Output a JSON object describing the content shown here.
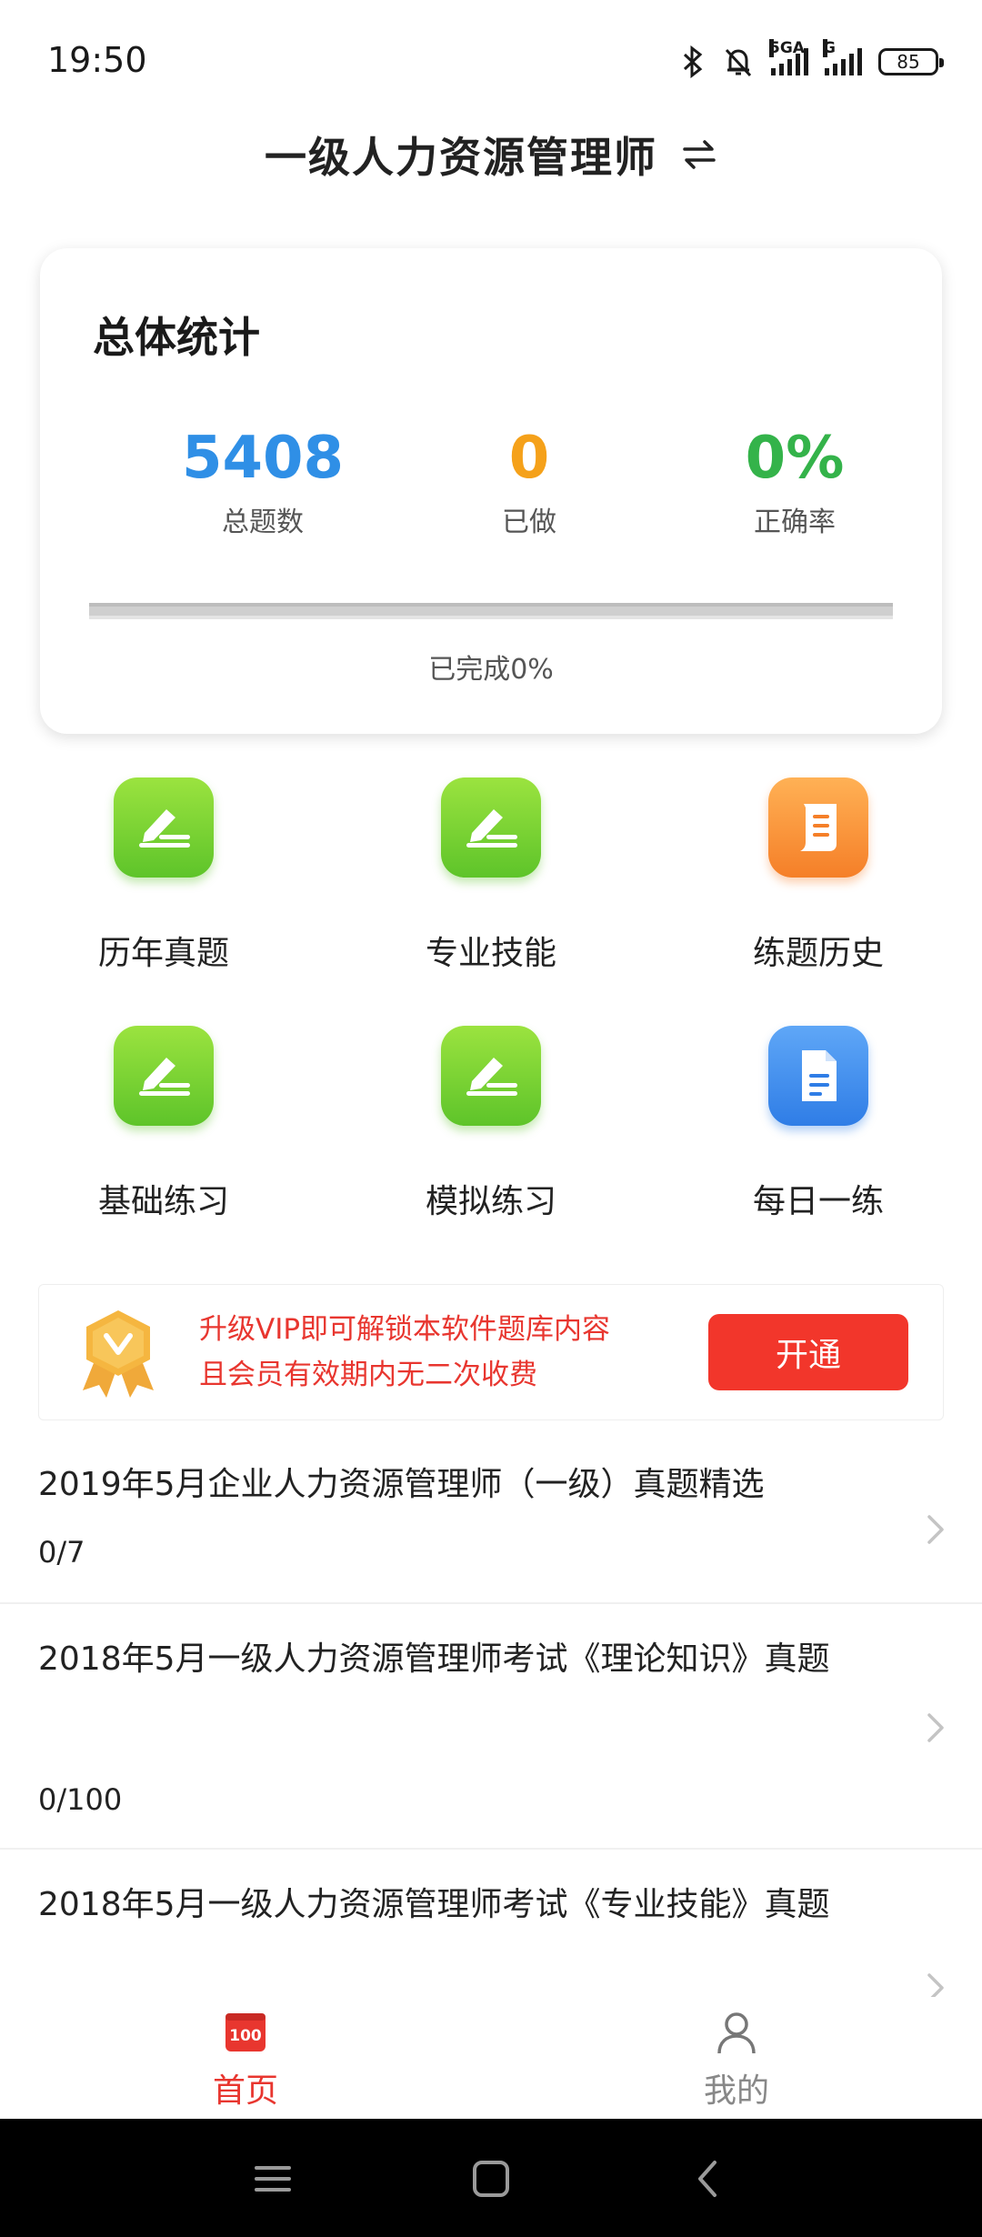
{
  "status": {
    "time": "19:50",
    "network1": "5GA",
    "network2": "G",
    "battery": "85"
  },
  "header": {
    "title": "一级人力资源管理师",
    "switch_icon": "swap-arrows-icon"
  },
  "stats": {
    "title": "总体统计",
    "total_value": "5408",
    "total_label": "总题数",
    "done_value": "0",
    "done_label": "已做",
    "rate_value": "0%",
    "rate_label": "正确率",
    "progress_fraction": 0,
    "progress_text": "已完成0%",
    "colors": {
      "total": "#2f8fe6",
      "done": "#f5a11a",
      "rate": "#34b34a"
    }
  },
  "grid": {
    "items": [
      {
        "label": "历年真题",
        "icon": "edit-pen-icon",
        "color": "green"
      },
      {
        "label": "专业技能",
        "icon": "edit-pen-icon",
        "color": "green"
      },
      {
        "label": "练题历史",
        "icon": "scroll-document-icon",
        "color": "orange"
      },
      {
        "label": "基础练习",
        "icon": "edit-pen-icon",
        "color": "green"
      },
      {
        "label": "模拟练习",
        "icon": "edit-pen-icon",
        "color": "green"
      },
      {
        "label": "每日一练",
        "icon": "file-icon",
        "color": "blue"
      }
    ]
  },
  "vip": {
    "line1": "升级VIP即可解锁本软件题库内容",
    "line2": "且会员有效期内无二次收费",
    "button": "开通",
    "accent": "#f2362b"
  },
  "list": [
    {
      "title": "2019年5月企业人力资源管理师（一级）真题精选",
      "progress": "0/7"
    },
    {
      "title": "2018年5月一级人力资源管理师考试《理论知识》真题",
      "progress": "0/100"
    },
    {
      "title": "2018年5月一级人力资源管理师考试《专业技能》真题",
      "progress": ""
    }
  ],
  "tabs": [
    {
      "label": "首页",
      "icon": "home-100-icon",
      "active": true
    },
    {
      "label": "我的",
      "icon": "user-icon",
      "active": false
    }
  ],
  "navbar": {
    "icons": [
      "menu-icon",
      "home-square-icon",
      "back-icon"
    ]
  }
}
